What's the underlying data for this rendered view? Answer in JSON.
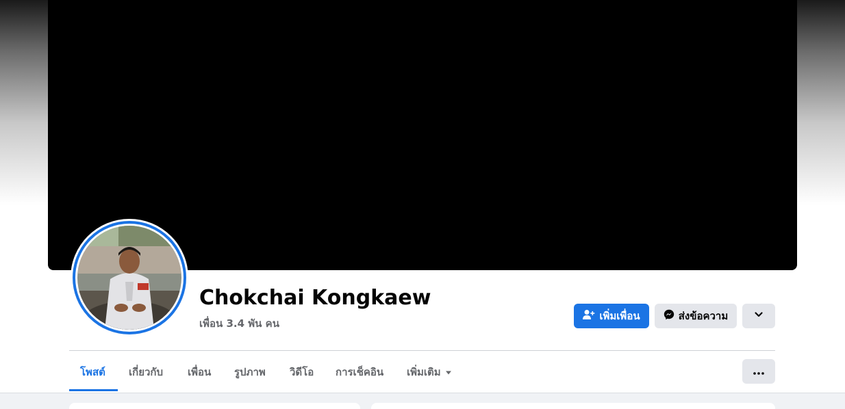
{
  "profile": {
    "name": "Chokchai Kongkaew",
    "friends_text": "เพื่อน 3.4 พัน คน"
  },
  "actions": {
    "add_friend_label": "เพิ่มเพื่อน",
    "message_label": "ส่งข้อความ"
  },
  "tabs": [
    {
      "label": "โพสต์",
      "active": true
    },
    {
      "label": "เกี่ยวกับ",
      "active": false
    },
    {
      "label": "เพื่อน",
      "active": false
    },
    {
      "label": "รูปภาพ",
      "active": false
    },
    {
      "label": "วิดีโอ",
      "active": false
    },
    {
      "label": "การเช็คอิน",
      "active": false
    },
    {
      "label": "เพิ่มเติม",
      "active": false
    }
  ],
  "icons": {
    "add_friend": "person-add-icon",
    "message": "messenger-icon",
    "chevron": "chevron-down-icon",
    "more": "ellipsis-icon",
    "more_tab_caret": "caret-down-icon"
  },
  "colors": {
    "accent": "#1b74e4",
    "button_gray": "#e4e6eb",
    "text_secondary": "#65676b",
    "page_bg": "#f0f2f5"
  }
}
